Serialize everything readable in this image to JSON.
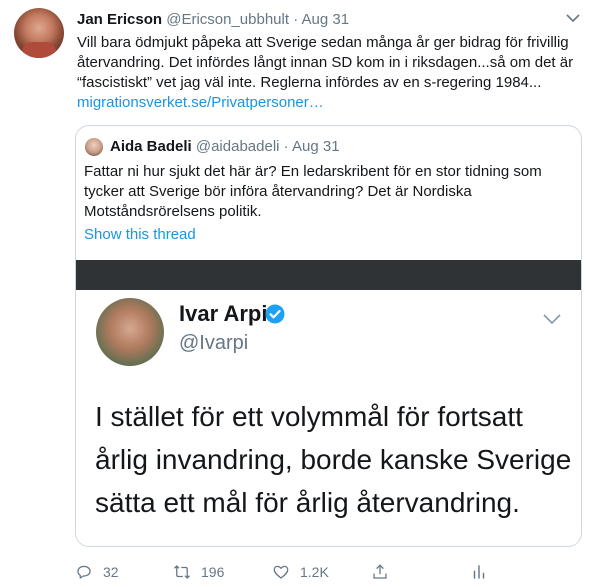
{
  "tweet": {
    "author_name": "Jan Ericson",
    "author_handle": "@Ericson_ubbhult",
    "separator": "·",
    "date": "Aug 31",
    "text_lines": [
      "Vill bara ödmjukt påpeka att Sverige sedan många år ger bidrag för frivillig",
      "återvandring. Det infördes långt innan SD kom in i riksdagen...så om det är",
      "“fascistiskt” vet jag väl inte. Reglerna infördes av en s-regering 1984..."
    ],
    "link_text": "migrationsverket.se/Privatpersoner…",
    "avatar_icon": "profile-photo-icon",
    "more_icon": "chevron-down-icon"
  },
  "quoted": {
    "author_name": "Aida Badeli",
    "author_handle": "@aidabadeli",
    "separator": "·",
    "date": "Aug 31",
    "text_lines": [
      "Fattar ni hur sjukt det här är? En ledarskribent för en stor tidning som",
      "tycker att Sverige bör införa återvandring? Det är Nordiska",
      "Motståndsrörelsens politik."
    ],
    "show_thread": "Show this thread",
    "image": {
      "name": "Ivar Arpi",
      "handle": "@Ivarpi",
      "text_lines": [
        "I stället för ett volymmål för fortsatt",
        "årlig invandring, borde kanske Sverige",
        "sätta ett mål för årlig återvandring."
      ]
    }
  },
  "actions": {
    "reply_count": "32",
    "retweet_count": "196",
    "like_count": "1.2K",
    "share_label": "",
    "analytics_label": ""
  },
  "colors": {
    "link": "#1b95e0",
    "secondary": "#657786",
    "verified": "#1da1f2",
    "image_band": "#2f3336"
  }
}
